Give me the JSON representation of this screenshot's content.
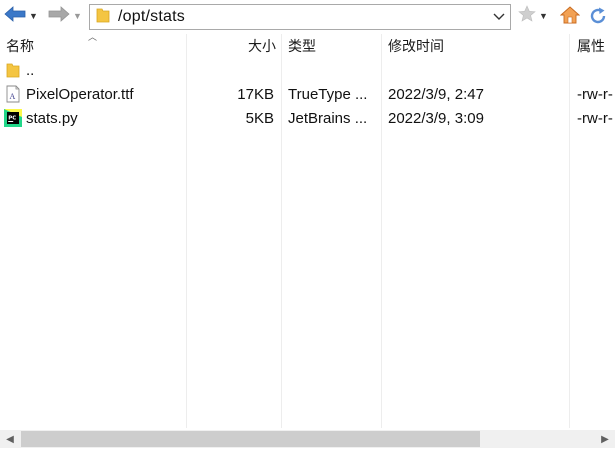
{
  "toolbar": {
    "path": "/opt/stats",
    "icons": {
      "back": "arrow-left-icon",
      "forward": "arrow-right-icon",
      "folder": "folder-icon",
      "favorites": "star-icon",
      "home": "home-icon",
      "refresh": "refresh-icon"
    }
  },
  "columns": {
    "name": "名称",
    "size": "大小",
    "type": "类型",
    "modified": "修改时间",
    "attributes": "属性"
  },
  "files": [
    {
      "name": "..",
      "size": "",
      "type": "",
      "modified": "",
      "attributes": "",
      "icon": "folder-icon"
    },
    {
      "name": "PixelOperator.ttf",
      "size": "17KB",
      "type": "TrueType ...",
      "modified": "2022/3/9, 2:47",
      "attributes": "-rw-r-",
      "icon": "font-file-icon"
    },
    {
      "name": "stats.py",
      "size": "5KB",
      "type": "JetBrains ...",
      "modified": "2022/3/9, 3:09",
      "attributes": "-rw-r-",
      "icon": "pycharm-file-icon"
    }
  ],
  "colors": {
    "accent_blue": "#3a7bd5",
    "folder_yellow": "#f4c542",
    "home_orange": "#e0853a"
  }
}
